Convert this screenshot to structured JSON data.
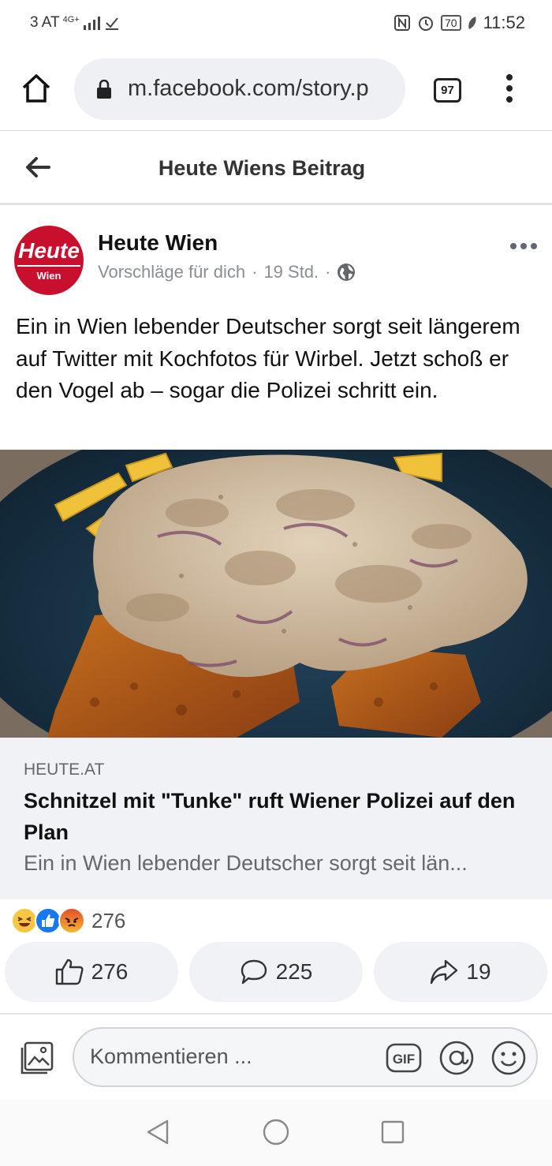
{
  "status_bar": {
    "carrier": "3 AT",
    "network": "4G+",
    "time": "11:52",
    "battery": "70"
  },
  "browser": {
    "url": "m.facebook.com/story.p",
    "tab_count": "97"
  },
  "header": {
    "title": "Heute Wiens Beitrag"
  },
  "post": {
    "avatar_text": "Heute",
    "avatar_sub": "Wien",
    "page_name": "Heute Wien",
    "suggested": "Vorschläge für dich",
    "sep1": "·",
    "time": "19 Std.",
    "sep2": "·",
    "text": "Ein in Wien lebender Deutscher sorgt seit längerem auf Twitter mit Kochfotos für Wirbel. Jetzt schoß er den Vogel ab – sogar die Polizei schritt ein."
  },
  "link": {
    "domain": "HEUTE.AT",
    "title": "Schnitzel mit \"Tunke\" ruft Wiener Polizei auf den Plan",
    "description": "Ein in Wien lebender Deutscher sorgt seit län..."
  },
  "reactions": {
    "icons": [
      "laughing-emoji-icon",
      "like-reaction-icon",
      "angry-emoji-icon"
    ],
    "count": "276"
  },
  "actions": {
    "likes": "276",
    "comments": "225",
    "shares": "19"
  },
  "comment": {
    "placeholder": "Kommentieren ...",
    "gif_label": "GIF"
  },
  "colors": {
    "brand_red": "#c8102e",
    "like_blue": "#1877f2",
    "card_bg": "#f0f2f5"
  }
}
